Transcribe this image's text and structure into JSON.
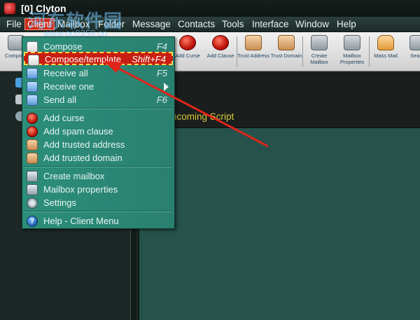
{
  "window": {
    "title": "[0] Clyton"
  },
  "watermark": {
    "text": "河东软件园",
    "url": "www.pc0359.cn"
  },
  "menubar": {
    "items": [
      {
        "label": "File"
      },
      {
        "label": "Client"
      },
      {
        "label": "Mailbox"
      },
      {
        "label": "Folder"
      },
      {
        "label": "Message"
      },
      {
        "label": "Contacts"
      },
      {
        "label": "Tools"
      },
      {
        "label": "Interface"
      },
      {
        "label": "Window"
      },
      {
        "label": "Help"
      }
    ]
  },
  "toolbar": {
    "buttons": [
      {
        "label": "Compose",
        "icon": "compose-icon"
      },
      {
        "label": "Add Curse",
        "icon": "curse-icon"
      },
      {
        "label": "Add Clause",
        "icon": "clause-icon"
      },
      {
        "label": "Trust Address",
        "icon": "trust-address-icon"
      },
      {
        "label": "Trust Domain",
        "icon": "trust-domain-icon"
      },
      {
        "label": "Create Mailbox",
        "icon": "create-mailbox-icon"
      },
      {
        "label": "Mailbox Properties",
        "icon": "mailbox-properties-icon"
      },
      {
        "label": "Mass Mail",
        "icon": "mass-mail-icon"
      },
      {
        "label": "Sea Al",
        "icon": "search-icon"
      }
    ]
  },
  "main": {
    "script_label": "ncoming Script"
  },
  "client_menu": {
    "items": [
      {
        "label": "Compose",
        "shortcut": "F4",
        "icon": "compose-icon"
      },
      {
        "label": "Compose/template",
        "shortcut": "Shift+F4",
        "icon": "template-icon",
        "selected": true
      },
      {
        "label": "Receive all",
        "shortcut": "F5",
        "icon": "receive-all-icon"
      },
      {
        "label": "Receive one",
        "shortcut": "",
        "icon": "receive-one-icon",
        "submenu": true
      },
      {
        "label": "Send all",
        "shortcut": "F6",
        "icon": "send-all-icon"
      },
      {
        "label": "Add curse",
        "icon": "curse-icon"
      },
      {
        "label": "Add spam clause",
        "icon": "spam-clause-icon"
      },
      {
        "label": "Add trusted address",
        "icon": "trusted-address-icon"
      },
      {
        "label": "Add trusted domain",
        "icon": "trusted-domain-icon"
      },
      {
        "label": "Create mailbox",
        "icon": "create-mailbox-icon"
      },
      {
        "label": "Mailbox properties",
        "icon": "mailbox-properties-icon"
      },
      {
        "label": "Settings",
        "icon": "settings-icon"
      },
      {
        "label": "Help - Client Menu",
        "icon": "help-icon"
      }
    ]
  },
  "colors": {
    "accent_red": "#cc2b1c",
    "menu_bg": "#2b8f7a",
    "highlight_border": "#ffd84a",
    "annotation_arrow": "#e0241b"
  }
}
